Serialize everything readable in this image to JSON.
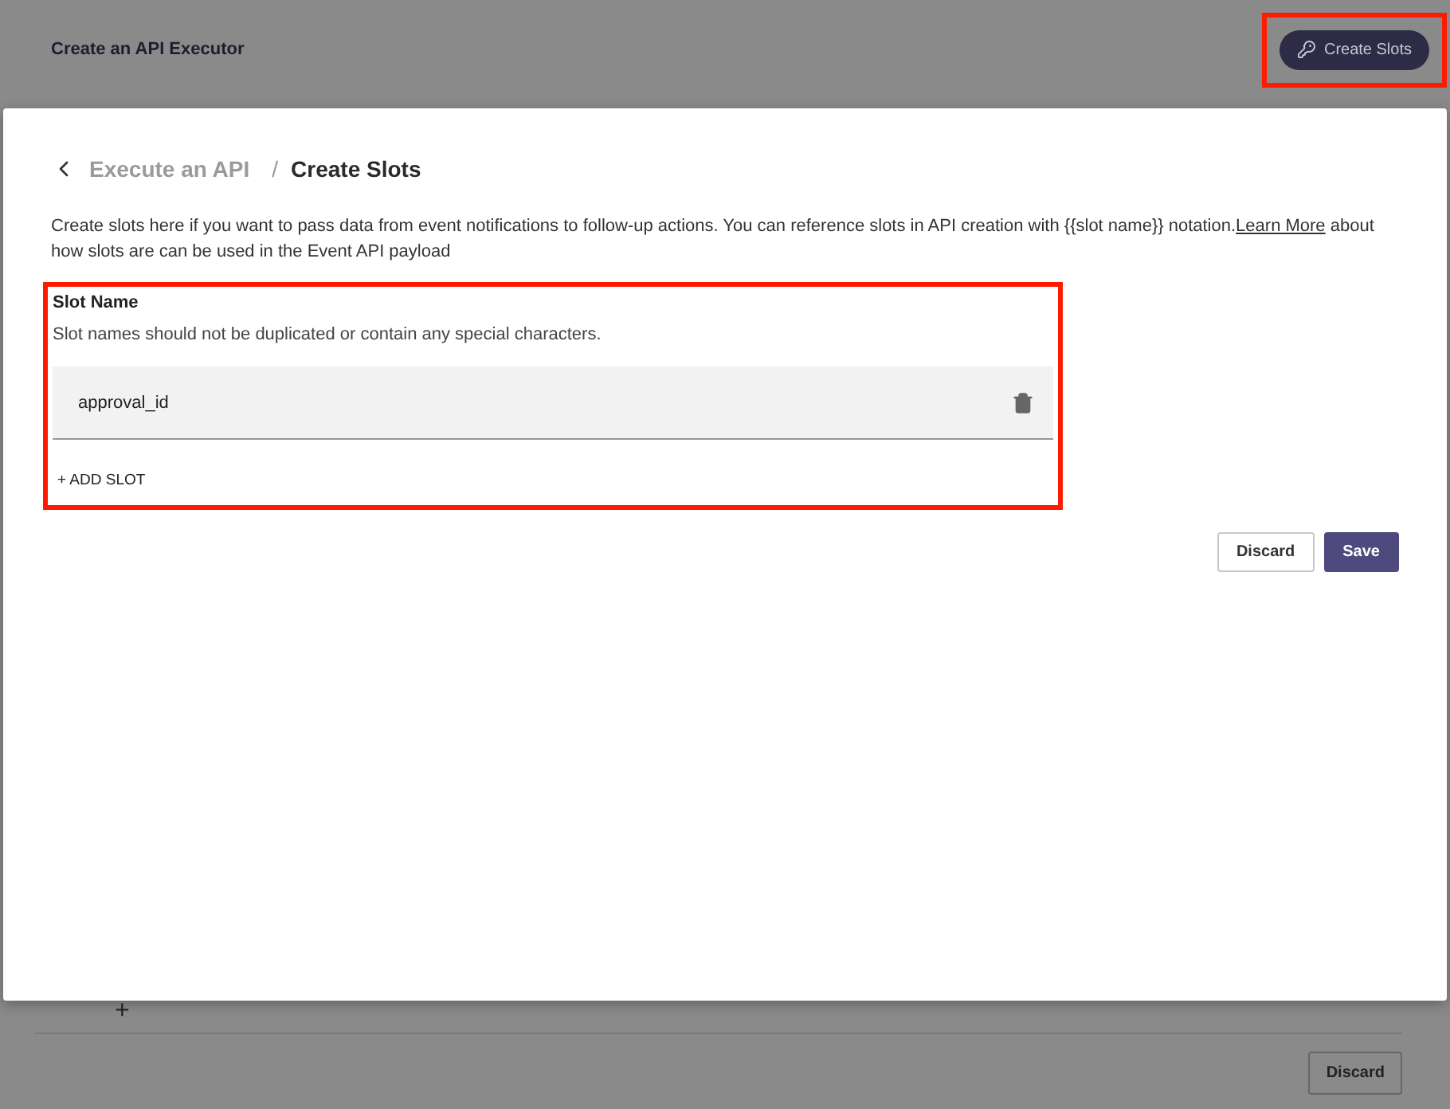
{
  "page": {
    "title": "Create an API Executor",
    "create_slots_button": "Create Slots",
    "add_symbol": "+",
    "discard_button": "Discard"
  },
  "modal": {
    "breadcrumb": [
      "Execute an API",
      "/",
      "Create Slots"
    ],
    "description": "Create slots here if you want to pass data from event notifications to follow-up actions. You can reference slots in API creation with {{slot name}} notation.",
    "learn_more": "Learn More",
    "description_end": " about how slots are can be used in the Event API payload",
    "section_title": "Slot Name",
    "hint": "Slot names should not be duplicated or contain any special characters.",
    "slots": [
      {
        "value": "approval_id"
      }
    ],
    "add_slot": "+ ADD SLOT",
    "buttons": [
      "Discard",
      "Save"
    ]
  }
}
